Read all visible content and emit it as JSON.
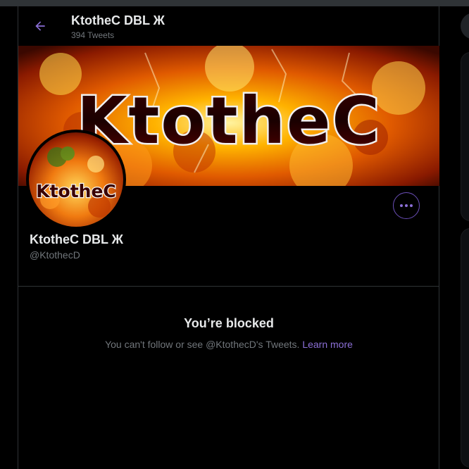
{
  "header": {
    "title": "KtotheC DBL Ж",
    "tweet_count": "394 Tweets"
  },
  "banner": {
    "text": "KtotheC"
  },
  "avatar": {
    "text": "KtotheC"
  },
  "profile": {
    "display_name": "KtotheC DBL Ж",
    "handle": "@KtothecD"
  },
  "blocked": {
    "title": "You’re blocked",
    "message": "You can't follow or see @KtothecD's Tweets.",
    "learn_more": "Learn more"
  },
  "icons": {
    "back": "back-arrow-icon",
    "more": "more-horizontal-icon"
  },
  "colors": {
    "accent": "#8b6fd6",
    "background": "#000000",
    "muted_text": "#71767b",
    "border": "#2f3336"
  }
}
